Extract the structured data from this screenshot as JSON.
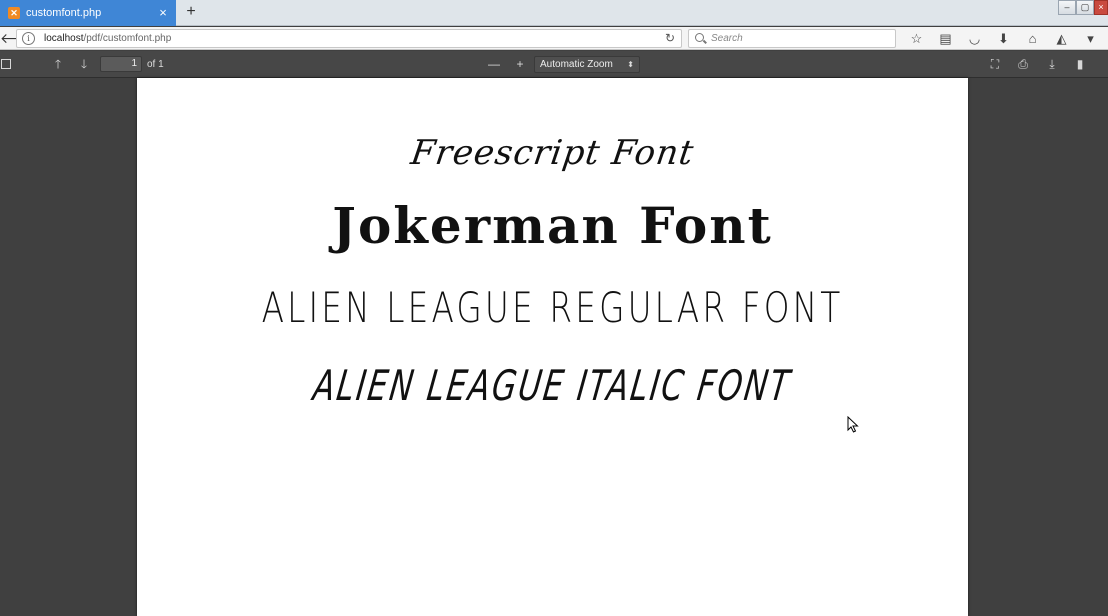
{
  "browser": {
    "tab": {
      "title": "customfont.php",
      "favicon": "xampp-icon"
    },
    "new_tab_label": "+",
    "url": {
      "host": "localhost",
      "path": "/pdf/customfont.php"
    },
    "search_placeholder": "Search"
  },
  "pdf_toolbar": {
    "page_number": "1",
    "page_count": "of 1",
    "zoom": "Automatic Zoom"
  },
  "document": {
    "lines": [
      "Freescript Font",
      "Jokerman Font",
      "ALIEN LEAGUE REGULAR FONT",
      "ALIEN LEAGUE ITALIC FONT"
    ]
  },
  "colors": {
    "tab_active": "#3f86d6",
    "pdf_toolbar": "#474747",
    "viewer_bg": "#404040",
    "page_bg": "#ffffff"
  }
}
